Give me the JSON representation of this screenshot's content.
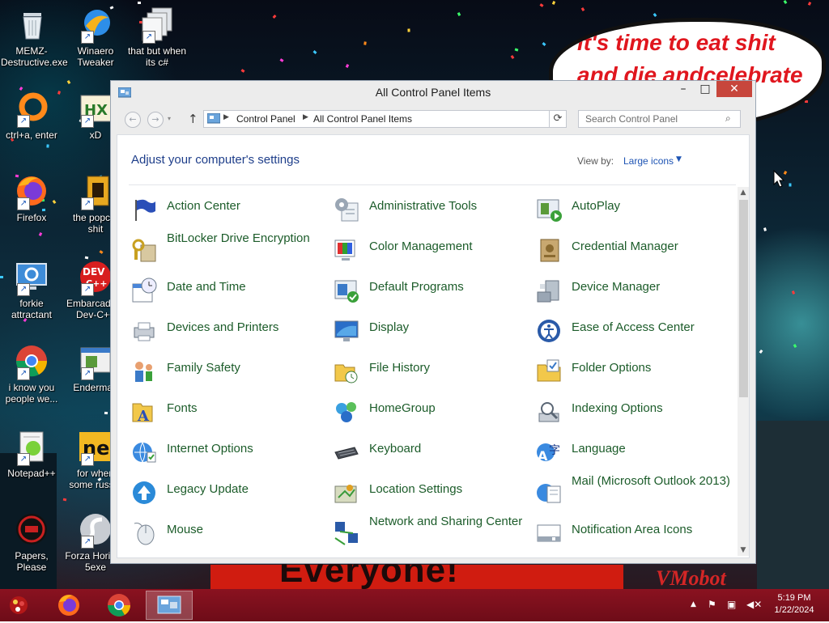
{
  "desktop": {
    "speech_bubble": {
      "line1": "it's time to eat shit",
      "line2": "and die andcelebrate"
    },
    "banner_text": "Everyone!",
    "corner_text": "VMobot",
    "icons": [
      {
        "label": "MEMZ-Destructive.exe",
        "icon": "recycle-bin-icon"
      },
      {
        "label": "Winaero Tweaker",
        "icon": "winaero-icon"
      },
      {
        "label": "that but when its c#",
        "icon": "files-icon"
      },
      {
        "label": "ctrl+a, enter",
        "icon": "orange-ring-icon"
      },
      {
        "label": "xD",
        "icon": "hxd-icon"
      },
      {
        "label": "Firefox",
        "icon": "firefox-icon"
      },
      {
        "label": "the popcat shit",
        "icon": "media-icon"
      },
      {
        "label": "forkie attractant",
        "icon": "monitor-gear-icon"
      },
      {
        "label": "Embarcadero Dev-C++",
        "icon": "devcpp-icon"
      },
      {
        "label": "i know you people we...",
        "icon": "chrome-icon"
      },
      {
        "label": "Enderman",
        "icon": "window-app-icon"
      },
      {
        "label": "Notepad++",
        "icon": "notepadpp-icon"
      },
      {
        "label": "for when some russ...",
        "icon": "ne-icon"
      },
      {
        "label": "Papers, Please",
        "icon": "papers-please-icon"
      },
      {
        "label": "Forza Horizon 5exe",
        "icon": "flash-icon"
      }
    ]
  },
  "window": {
    "title": "All Control Panel Items",
    "minimize": "–",
    "maximize": "□",
    "close": "✕",
    "nav": {
      "back": "←",
      "forward": "→",
      "up": "↑"
    },
    "breadcrumb": [
      "Control Panel",
      "All Control Panel Items"
    ],
    "search_placeholder": "Search Control Panel",
    "heading": "Adjust your computer's settings",
    "view_by_label": "View by:",
    "view_by_value": "Large icons",
    "items": [
      {
        "label": "Action Center",
        "icon": "flag-icon"
      },
      {
        "label": "Administrative Tools",
        "icon": "admin-tools-icon"
      },
      {
        "label": "AutoPlay",
        "icon": "autoplay-icon"
      },
      {
        "label": "BitLocker Drive Encryption",
        "icon": "bitlocker-icon"
      },
      {
        "label": "Color Management",
        "icon": "color-management-icon"
      },
      {
        "label": "Credential Manager",
        "icon": "credential-icon"
      },
      {
        "label": "Date and Time",
        "icon": "calendar-clock-icon"
      },
      {
        "label": "Default Programs",
        "icon": "default-programs-icon"
      },
      {
        "label": "Device Manager",
        "icon": "device-manager-icon"
      },
      {
        "label": "Devices and Printers",
        "icon": "printer-icon"
      },
      {
        "label": "Display",
        "icon": "display-icon"
      },
      {
        "label": "Ease of Access Center",
        "icon": "ease-of-access-icon"
      },
      {
        "label": "Family Safety",
        "icon": "family-icon"
      },
      {
        "label": "File History",
        "icon": "file-history-icon"
      },
      {
        "label": "Folder Options",
        "icon": "folder-options-icon"
      },
      {
        "label": "Fonts",
        "icon": "fonts-icon"
      },
      {
        "label": "HomeGroup",
        "icon": "homegroup-icon"
      },
      {
        "label": "Indexing Options",
        "icon": "indexing-icon"
      },
      {
        "label": "Internet Options",
        "icon": "internet-options-icon"
      },
      {
        "label": "Keyboard",
        "icon": "keyboard-icon"
      },
      {
        "label": "Language",
        "icon": "language-icon"
      },
      {
        "label": "Legacy Update",
        "icon": "legacy-update-icon"
      },
      {
        "label": "Location Settings",
        "icon": "location-icon"
      },
      {
        "label": "Mail (Microsoft Outlook 2013)",
        "icon": "mail-icon"
      },
      {
        "label": "Mouse",
        "icon": "mouse-icon"
      },
      {
        "label": "Network and Sharing Center",
        "icon": "network-icon"
      },
      {
        "label": "Notification Area Icons",
        "icon": "notification-icon"
      }
    ]
  },
  "taskbar": {
    "time": "5:19 PM",
    "date": "1/22/2024",
    "apps": [
      "firefox-icon",
      "chrome-icon",
      "control-panel-icon"
    ]
  }
}
